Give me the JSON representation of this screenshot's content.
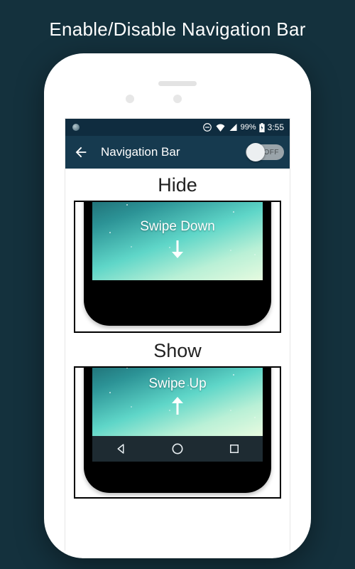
{
  "page": {
    "title": "Enable/Disable Navigation Bar"
  },
  "status": {
    "battery_pct": "99%",
    "time": "3:55"
  },
  "appbar": {
    "title": "Navigation Bar",
    "toggle_state": "OFF"
  },
  "sections": {
    "hide": {
      "label": "Hide",
      "instruction": "Swipe Down"
    },
    "show": {
      "label": "Show",
      "instruction": "Swipe Up"
    }
  },
  "icons": {
    "back": "back-arrow-icon",
    "dnd": "dnd-icon",
    "wifi": "wifi-icon",
    "signal": "signal-icon",
    "battery": "battery-icon",
    "arrow_down": "arrow-down-icon",
    "arrow_up": "arrow-up-icon",
    "nav_back": "nav-back-icon",
    "nav_home": "nav-home-icon",
    "nav_recent": "nav-recent-icon"
  }
}
